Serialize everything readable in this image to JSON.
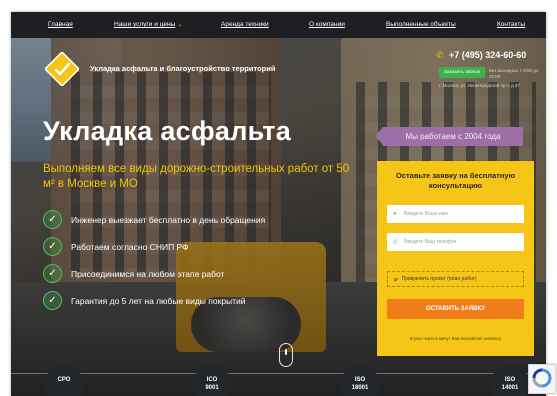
{
  "nav": {
    "items": [
      "Главная",
      "Наши услуги и цены",
      "Аренда техники",
      "О компании",
      "Выполненные объекты",
      "Контакты"
    ]
  },
  "header": {
    "brand": "Укладка асфальта и благоустройство территорий",
    "phone": "+7 (495) 324-60-60",
    "callback_label": "Заказать звонок",
    "hours": "Без выходных с 8:00 до 22:00",
    "address": "г. Москва, ул. Ленинградский пр-т, д.47"
  },
  "hero": {
    "title": "Укладка асфальта",
    "subtitle": "Выполняем все виды дорожно-строительных работ от 50 м² в Москве и МО",
    "badge": "Мы работаем с 2004 года",
    "features": [
      "Инженер выезжает бесплатно в день обращения",
      "Работаем согласно СНИП РФ",
      "Присоединимся на любом этапе работ",
      "Гарантия до 5 лет на любые виды покрытий"
    ]
  },
  "form": {
    "title": "Оставьте заявку на бесплатную консультацию",
    "name_placeholder": "Введите Ваше имя",
    "phone_placeholder": "Введите Ваш телефон",
    "attach_label": "Прикрепить проект (план работ)",
    "submit_label": "ОСТАВИТЬ ЗАЯВКУ",
    "note": "В указ через 5 минут Вам перезвонит инженер"
  },
  "certificates": [
    {
      "line1": "СРО",
      "line2": ""
    },
    {
      "line1": "ICO",
      "line2": "9001"
    },
    {
      "line1": "ISO",
      "line2": "18001"
    },
    {
      "line1": "ISO",
      "line2": "14001"
    }
  ],
  "colors": {
    "accent_yellow": "#f5c518",
    "submit_orange": "#f07d1a",
    "badge_purple": "#9e6ea6",
    "check_green": "#58b85f",
    "nav_dark": "#1d1f22"
  },
  "icons": {
    "phone": "phone-icon",
    "user": "user-icon",
    "attach": "paperclip-icon",
    "check": "check-icon"
  }
}
